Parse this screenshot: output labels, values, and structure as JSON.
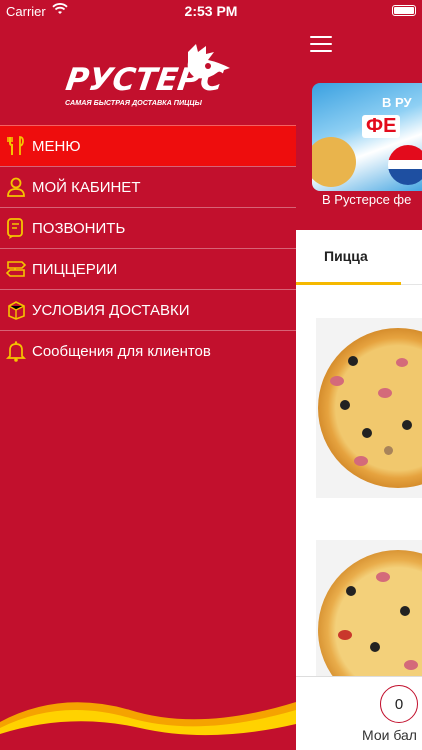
{
  "status_bar": {
    "carrier": "Carrier",
    "time": "2:53 PM"
  },
  "logo": {
    "name": "РУСТЕРС",
    "tagline": "САМАЯ БЫСТРАЯ ДОСТАВКА ПИЦЦЫ"
  },
  "menu": {
    "items": [
      {
        "label": "МЕНЮ",
        "icon": "fork-knife-icon",
        "active": true
      },
      {
        "label": "МОЙ КАБИНЕТ",
        "icon": "user-icon",
        "active": false
      },
      {
        "label": "ПОЗВОНИТЬ",
        "icon": "phone-chat-icon",
        "active": false
      },
      {
        "label": "ПИЦЦЕРИИ",
        "icon": "signpost-icon",
        "active": false
      },
      {
        "label": "УСЛОВИЯ ДОСТАВКИ",
        "icon": "delivery-box-icon",
        "active": false
      },
      {
        "label": "Сообщения для клиентов",
        "icon": "bell-icon",
        "active": false
      }
    ]
  },
  "main": {
    "promo_caption": "В Рустерсе фе",
    "banner_text_top": "В РУ",
    "banner_text_mid": "ФЕ",
    "tabs": [
      {
        "label": "Пицца",
        "active": true
      }
    ],
    "points_value": "0",
    "points_label": "Мои бал"
  },
  "colors": {
    "brand_red": "#c2102d",
    "active_red": "#ee0d0d",
    "accent_yellow": "#f5b800",
    "icon_yellow": "#f5c400"
  }
}
